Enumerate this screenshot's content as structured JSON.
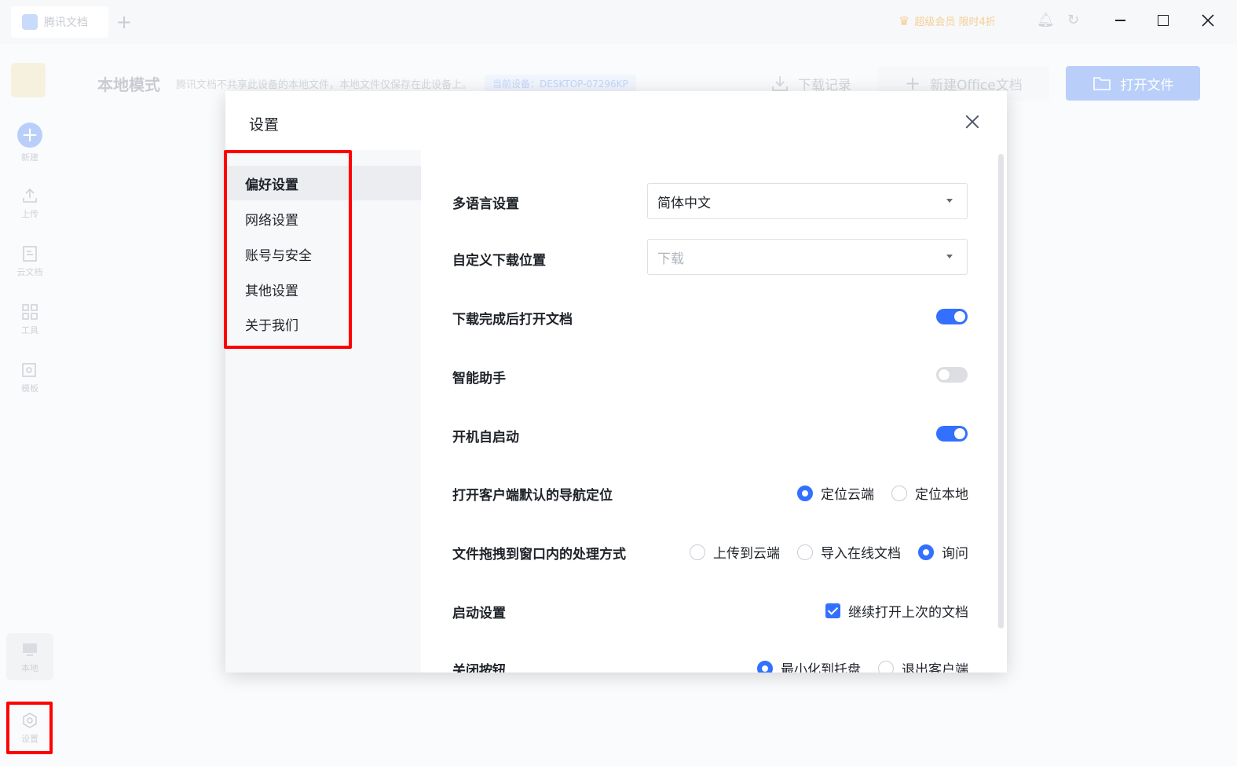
{
  "app": {
    "tab_label": "腾讯文档",
    "promo_text": "超级会员 限时4折",
    "mode_title": "本地模式",
    "mode_desc": "腾讯文档不共享此设备的本地文件，本地文件仅保存在此设备上。",
    "device_chip": "当前设备：DESKTOP-07296KP",
    "download_record": "下载记录",
    "new_office": "新建Office文档",
    "open_file": "打开文件"
  },
  "sidebar": {
    "items": [
      {
        "label": "新建",
        "icon": "plus-circle-icon"
      },
      {
        "label": "上传",
        "icon": "upload-icon"
      },
      {
        "label": "云文档",
        "icon": "document-icon"
      },
      {
        "label": "工具",
        "icon": "grid-icon"
      },
      {
        "label": "模板",
        "icon": "template-icon"
      },
      {
        "label": "本地",
        "icon": "monitor-icon"
      },
      {
        "label": "设置",
        "icon": "settings-icon"
      }
    ]
  },
  "dialog": {
    "title": "设置",
    "nav": [
      "偏好设置",
      "网络设置",
      "账号与安全",
      "其他设置",
      "关于我们"
    ],
    "language": {
      "label": "多语言设置",
      "value": "简体中文"
    },
    "download_location": {
      "label": "自定义下载位置",
      "placeholder": "下载"
    },
    "open_after_download": {
      "label": "下载完成后打开文档",
      "on": true
    },
    "smart_assistant": {
      "label": "智能助手",
      "on": false
    },
    "autostart": {
      "label": "开机自启动",
      "on": true
    },
    "nav_position": {
      "label": "打开客户端默认的导航定位",
      "options": [
        "定位云端",
        "定位本地"
      ],
      "selected": 0
    },
    "drag_handling": {
      "label": "文件拖拽到窗口内的处理方式",
      "options": [
        "上传到云端",
        "导入在线文档",
        "询问"
      ],
      "selected": 2
    },
    "startup": {
      "label": "启动设置",
      "checkbox": "继续打开上次的文档",
      "checked": true
    },
    "close_button": {
      "label": "关闭按钮",
      "options": [
        "最小化到托盘",
        "退出客户端"
      ],
      "selected": 0
    }
  },
  "colors": {
    "accent": "#3370ff",
    "highlight": "#ff0000"
  }
}
